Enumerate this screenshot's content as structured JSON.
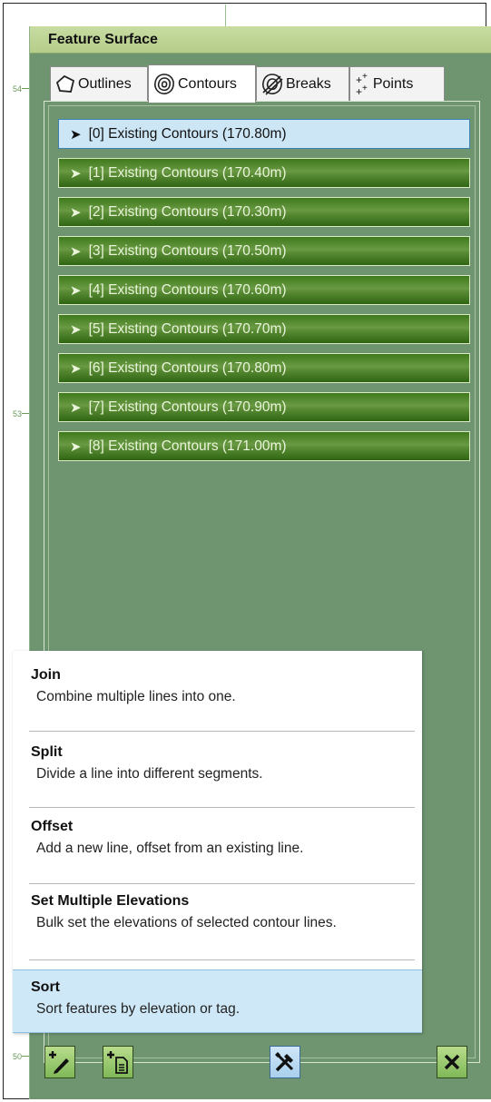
{
  "window": {
    "title": "Feature Surface"
  },
  "ruler": {
    "labels": [
      "54",
      "53",
      "50"
    ]
  },
  "tabs": [
    {
      "label": "Outlines",
      "icon": "outline-shape-icon",
      "active": false
    },
    {
      "label": "Contours",
      "icon": "contours-icon",
      "active": true
    },
    {
      "label": "Breaks",
      "icon": "breaks-icon",
      "active": false
    },
    {
      "label": "Points",
      "icon": "points-icon",
      "active": false
    }
  ],
  "contours": [
    {
      "label": "[0] Existing Contours (170.80m)",
      "selected": true
    },
    {
      "label": "[1] Existing Contours (170.40m)",
      "selected": false
    },
    {
      "label": "[2] Existing Contours (170.30m)",
      "selected": false
    },
    {
      "label": "[3] Existing Contours (170.50m)",
      "selected": false
    },
    {
      "label": "[4] Existing Contours (170.60m)",
      "selected": false
    },
    {
      "label": "[5] Existing Contours (170.70m)",
      "selected": false
    },
    {
      "label": "[6] Existing Contours (170.80m)",
      "selected": false
    },
    {
      "label": "[7] Existing Contours (170.90m)",
      "selected": false
    },
    {
      "label": "[8] Existing Contours (171.00m)",
      "selected": false
    }
  ],
  "menu": [
    {
      "title": "Join",
      "desc": "Combine multiple lines into one.",
      "active": false
    },
    {
      "title": "Split",
      "desc": "Divide a line into different segments.",
      "active": false
    },
    {
      "title": "Offset",
      "desc": "Add a new line, offset from an existing line.",
      "active": false
    },
    {
      "title": "Set Multiple Elevations",
      "desc": "Bulk set the elevations of selected contour lines.",
      "active": false
    },
    {
      "title": "Sort",
      "desc": "Sort features by elevation or tag.",
      "active": true
    }
  ],
  "toolbar": {
    "buttons": [
      {
        "name": "add-line-button",
        "icon": "add-pencil-icon"
      },
      {
        "name": "add-document-button",
        "icon": "add-document-icon"
      },
      {
        "name": "tools-button",
        "icon": "tools-icon"
      },
      {
        "name": "close-button",
        "icon": "close-icon"
      }
    ]
  },
  "colors": {
    "panel_bg": "#6e9470",
    "row_green": "#4f8a2a",
    "selected_row": "#cde6f5",
    "menu_active": "#cfe8f7"
  }
}
